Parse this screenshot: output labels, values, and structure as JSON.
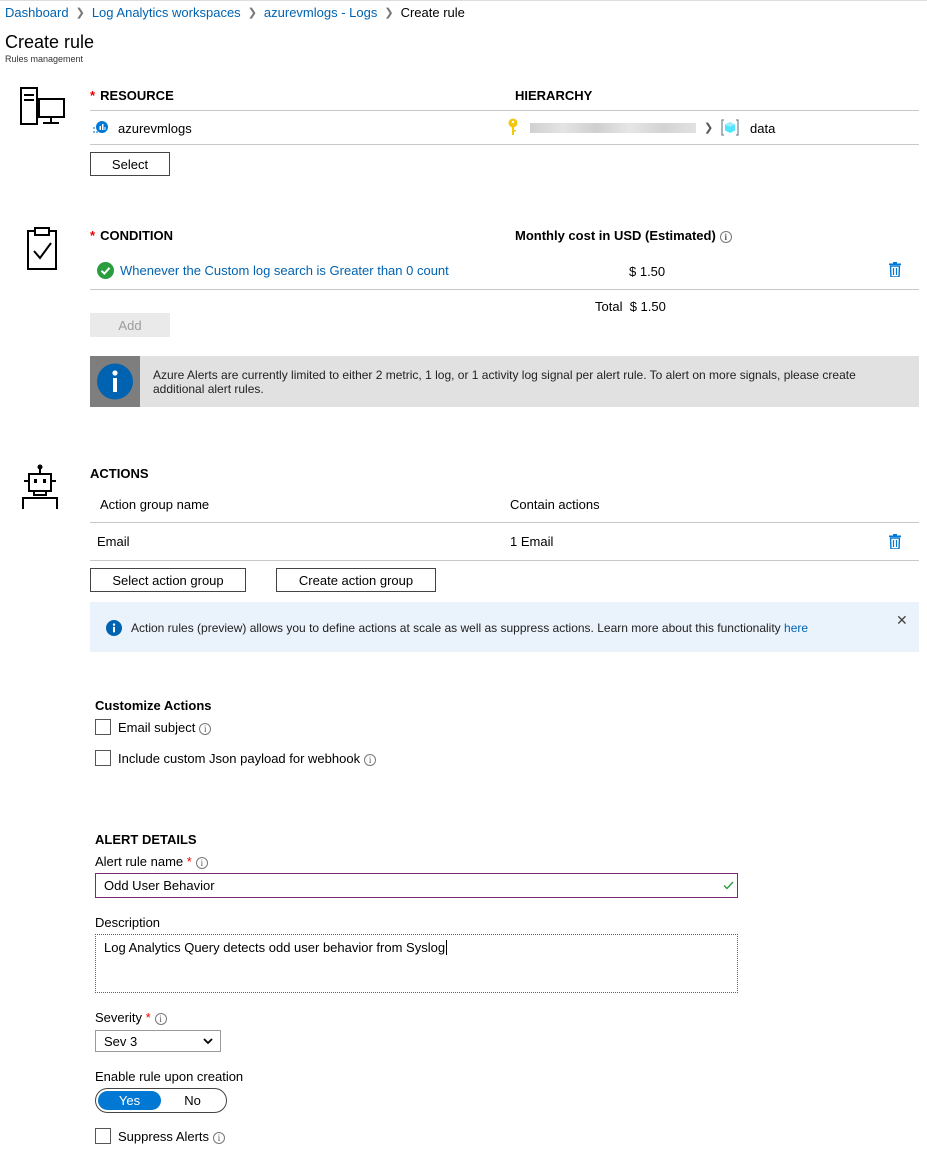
{
  "breadcrumb": {
    "items": [
      "Dashboard",
      "Log Analytics workspaces",
      "azurevmlogs - Logs"
    ],
    "current": "Create rule"
  },
  "page": {
    "title": "Create rule",
    "subtitle": "Rules management"
  },
  "resource": {
    "header": "RESOURCE",
    "hierarchy_header": "HIERARCHY",
    "name": "azurevmlogs",
    "hierarchy_leaf": "data",
    "select_label": "Select"
  },
  "condition": {
    "header": "CONDITION",
    "cost_header": "Monthly cost in USD (Estimated)",
    "item_text": "Whenever the Custom log search is Greater than 0 count",
    "item_cost": "$ 1.50",
    "total_label": "Total",
    "total_value": "$ 1.50",
    "add_label": "Add",
    "info_text": "Azure Alerts are currently limited to either 2 metric, 1 log, or 1 activity log signal per alert rule. To alert on more signals, please create additional alert rules."
  },
  "actions": {
    "header": "ACTIONS",
    "col_name": "Action group name",
    "col_contain": "Contain actions",
    "row_name": "Email",
    "row_contain": "1 Email",
    "select_group_label": "Select action group",
    "create_group_label": "Create action group",
    "banner_text": "Action rules (preview) allows you to define actions at scale as well as suppress actions. Learn more about this functionality",
    "banner_link": "here"
  },
  "customize": {
    "header": "Customize Actions",
    "email_subject": "Email subject",
    "json_payload": "Include custom Json payload for webhook"
  },
  "details": {
    "header": "ALERT DETAILS",
    "name_label": "Alert rule name",
    "name_value": "Odd User Behavior",
    "desc_label": "Description",
    "desc_value": "Log Analytics Query detects odd user behavior from Syslog",
    "severity_label": "Severity",
    "severity_value": "Sev 3",
    "enable_label": "Enable rule upon creation",
    "enable_yes": "Yes",
    "enable_no": "No",
    "suppress_label": "Suppress Alerts"
  },
  "colors": {
    "link": "#0063b1",
    "accent": "#0078d4",
    "success": "#2a9d3e",
    "required": "#e00000",
    "key": "#f2c811"
  }
}
